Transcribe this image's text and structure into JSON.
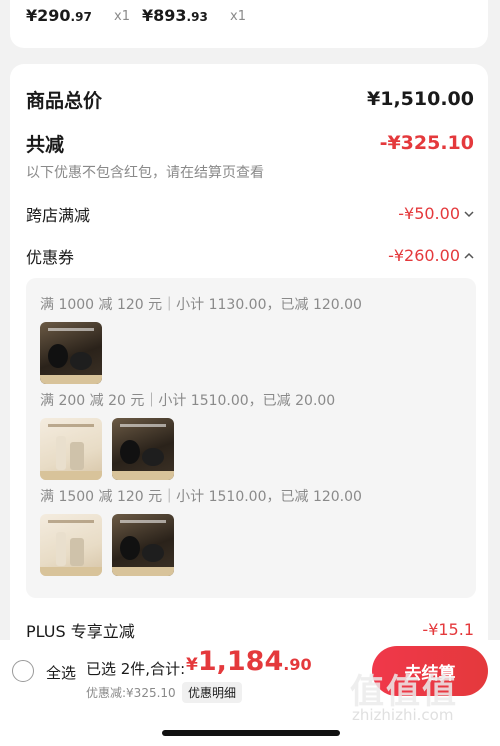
{
  "top_items": [
    {
      "price_int": "¥290",
      "price_dec": ".97",
      "qty": "x1"
    },
    {
      "price_int": "¥893",
      "price_dec": ".93",
      "qty": "x1"
    }
  ],
  "summary": {
    "total_label": "商品总价",
    "total_value": "¥1,510.00",
    "reduce_label": "共减",
    "reduce_value": "-¥325.10",
    "hint": "以下优惠不包含红包，请在结算页查看",
    "cross_store_label": "跨店满减",
    "cross_store_value": "-¥50.00",
    "coupon_label": "优惠券",
    "coupon_value": "-¥260.00",
    "plus_label": "PLUS 专享立减",
    "plus_value": "-¥15.1"
  },
  "coupons": [
    {
      "text": "满 1000 减 120 元｜小计 1130.00，已减 120.00"
    },
    {
      "text": "满 200 减 20 元｜小计 1510.00，已减 20.00"
    },
    {
      "text": "满 1500 减 120 元｜小计 1510.00，已减 120.00"
    }
  ],
  "bottom": {
    "select_all": "全选",
    "selected": "已选 2件,合计:",
    "currency": "¥",
    "total_int": "1,184",
    "total_dec": ".90",
    "discount": "优惠减:¥325.10",
    "detail": "优惠明细",
    "checkout": "去结算"
  },
  "watermark": {
    "text": "zhizhizhi.com"
  },
  "colors": {
    "accent": "#e4393c",
    "muted": "#8a8a8a",
    "background": "#f2f2f2"
  },
  "icons": [
    "chevron-down-icon",
    "chevron-up-icon",
    "radio-icon"
  ]
}
